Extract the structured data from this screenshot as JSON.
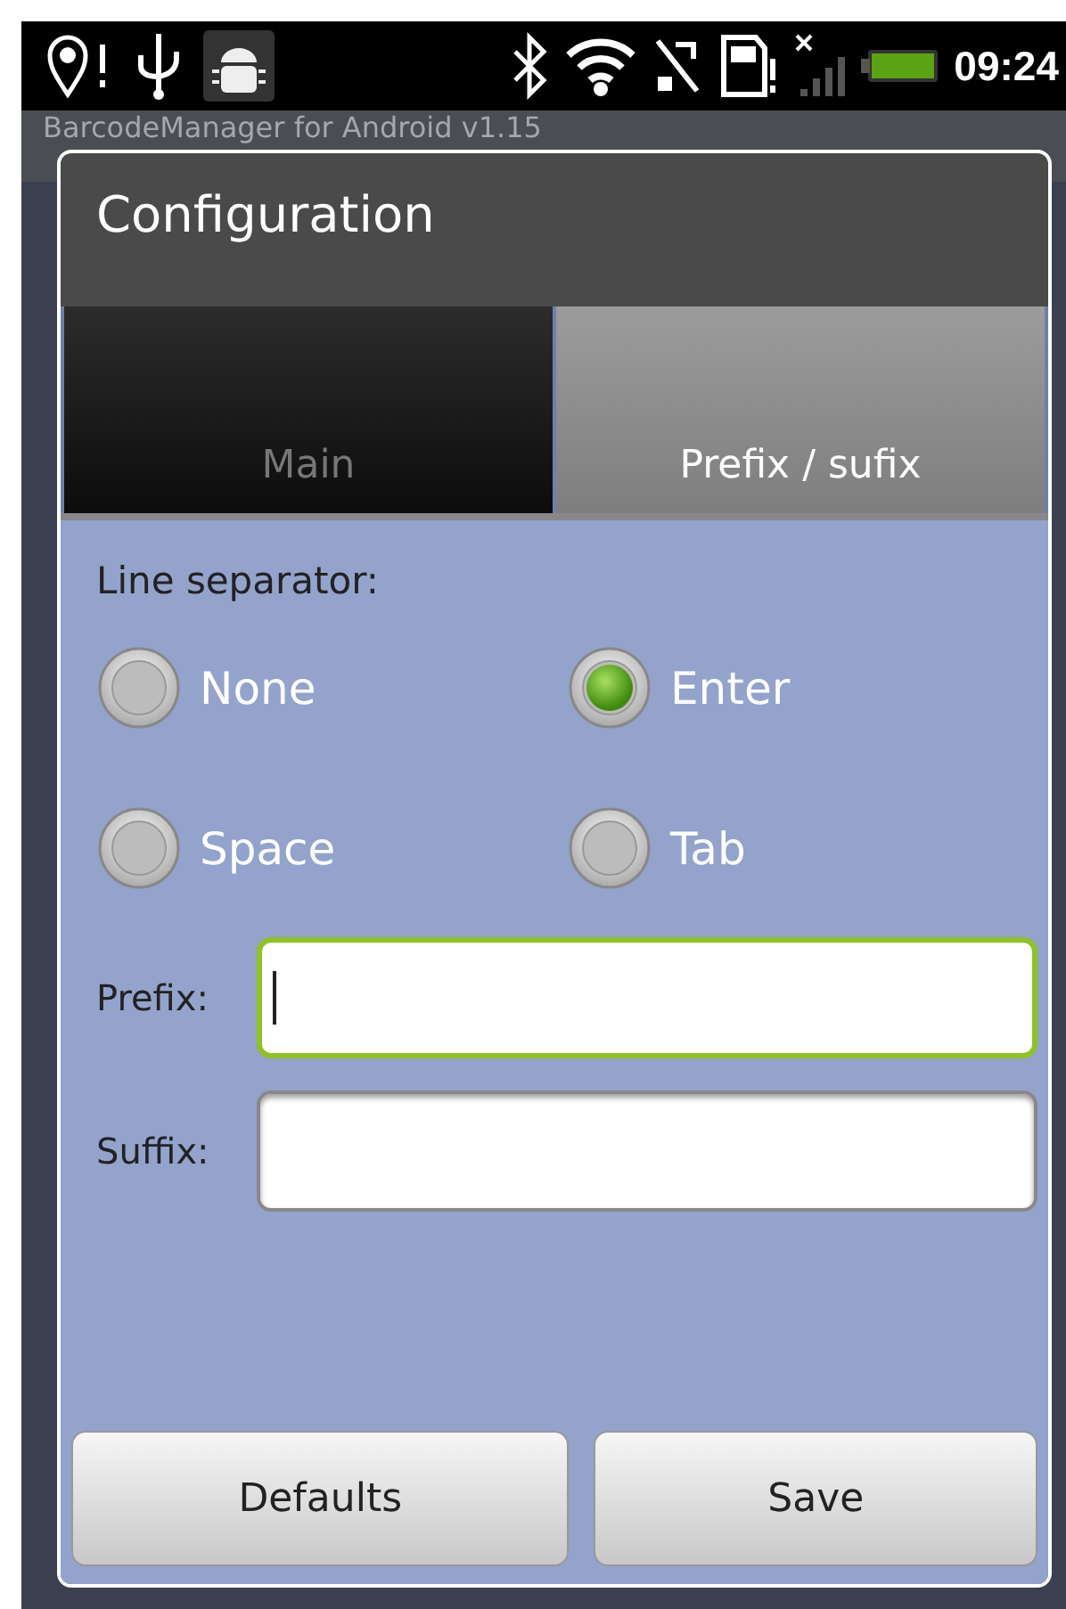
{
  "status_bar": {
    "time": "09:24"
  },
  "app_title": "BarcodeManager for Android v1.15",
  "dialog": {
    "title": "Configuration",
    "tabs": [
      {
        "label": "Main",
        "selected": false
      },
      {
        "label": "Prefix / sufix",
        "selected": true
      }
    ],
    "separator_label": "Line separator:",
    "radios": [
      {
        "label": "None",
        "selected": false
      },
      {
        "label": "Enter",
        "selected": true
      },
      {
        "label": "Space",
        "selected": false
      },
      {
        "label": "Tab",
        "selected": false
      }
    ],
    "fields": [
      {
        "label": "Prefix:",
        "focused": true
      },
      {
        "label": "Suffix:",
        "focused": false
      }
    ],
    "buttons": [
      "Defaults",
      "Save"
    ]
  }
}
